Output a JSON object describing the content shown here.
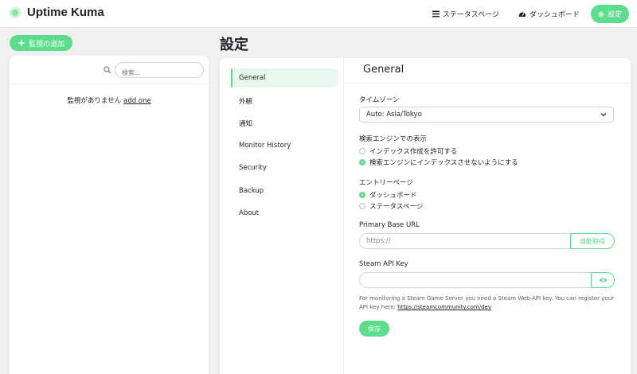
{
  "header": {
    "title": "Uptime Kuma",
    "nav": {
      "status_page": "ステータスページ",
      "dashboard": "ダッシュボード",
      "settings": "設定"
    }
  },
  "left": {
    "add_button": "監視の追加",
    "search_placeholder": "検索...",
    "empty_text": "監視がありません",
    "empty_link": "add one"
  },
  "settings": {
    "page_title": "設定",
    "menu": [
      "General",
      "外観",
      "通知",
      "Monitor History",
      "Security",
      "Backup",
      "About"
    ],
    "active_menu": "General",
    "section_title": "General",
    "timezone": {
      "label": "タイムゾーン",
      "value": "Auto: Asia/Tokyo"
    },
    "search_engine": {
      "label": "検索エンジンでの表示",
      "options": [
        "インデックス作成を許可する",
        "検索エンジンにインデックスさせないようにする"
      ],
      "selected": 1
    },
    "entry_page": {
      "label": "エントリーページ",
      "options": [
        "ダッシュボード",
        "ステータスページ"
      ],
      "selected": 0
    },
    "base_url": {
      "label": "Primary Base URL",
      "placeholder": "https://",
      "value": "",
      "auto_button": "自動取得"
    },
    "steam": {
      "label": "Steam API Key",
      "value": "",
      "help": "For monitoring a Steam Game Server you need a Steam Web-API key. You can register your API key here:",
      "help_link": "https://steamcommunity.com/dev"
    },
    "save_button": "保存"
  },
  "colors": {
    "accent": "#5cdd8b",
    "background": "#f0f0f1"
  }
}
